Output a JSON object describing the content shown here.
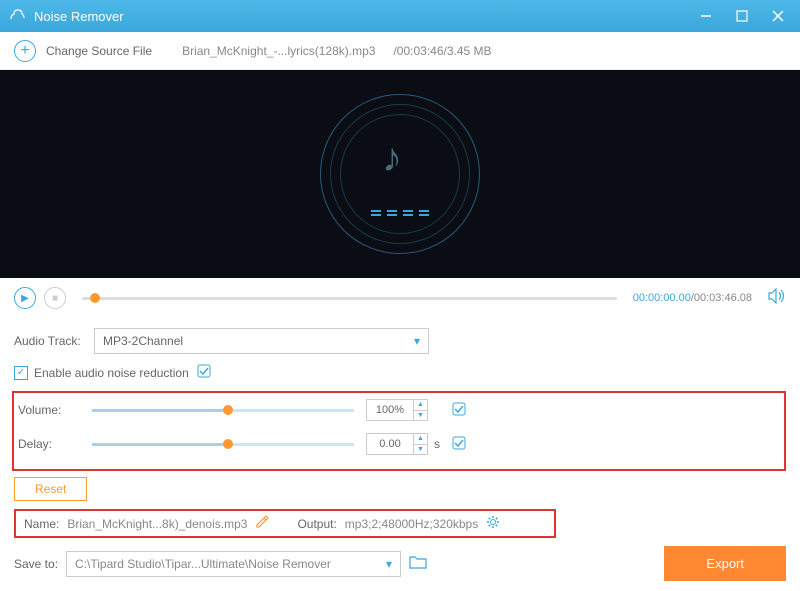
{
  "titlebar": {
    "title": "Noise Remover"
  },
  "toolbar": {
    "change_source": "Change Source File",
    "filename": "Brian_McKnight_-...lyrics(128k).mp3",
    "fileinfo": "/00:03:46/3.45 MB"
  },
  "player": {
    "current": "00:00:00.00",
    "total": "/00:03:46.08"
  },
  "audio_track": {
    "label": "Audio Track:",
    "value": "MP3-2Channel"
  },
  "noise": {
    "label": "Enable audio noise reduction"
  },
  "volume": {
    "label": "Volume:",
    "value": "100%",
    "fill_pct": 50
  },
  "delay": {
    "label": "Delay:",
    "value": "0.00",
    "unit": "s",
    "fill_pct": 50
  },
  "reset": "Reset",
  "output": {
    "name_label": "Name:",
    "name_value": "Brian_McKnight...8k)_denois.mp3",
    "output_label": "Output:",
    "output_value": "mp3;2;48000Hz;320kbps"
  },
  "saveto": {
    "label": "Save to:",
    "path": "C:\\Tipard Studio\\Tipar...Ultimate\\Noise Remover"
  },
  "export": "Export"
}
